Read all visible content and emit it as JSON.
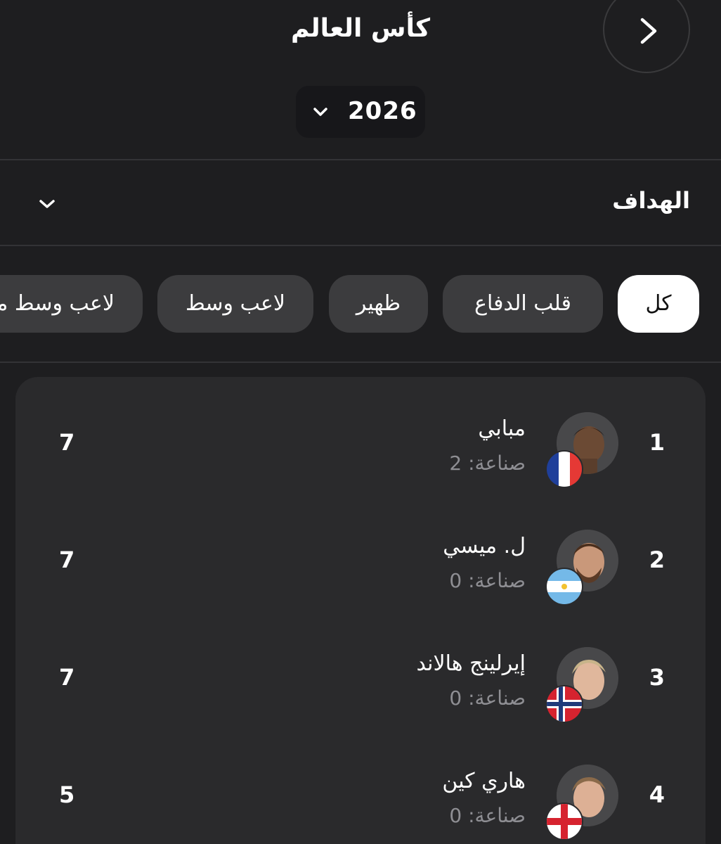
{
  "header": {
    "title": "كأس العالم",
    "year": "2026"
  },
  "stat_selector": {
    "label": "الهداف"
  },
  "positions": [
    {
      "label": "كل",
      "active": true
    },
    {
      "label": "قلب الدفاع",
      "active": false
    },
    {
      "label": "ظهير",
      "active": false
    },
    {
      "label": "لاعب وسط",
      "active": false
    },
    {
      "label": "لاعب وسط مهاجم",
      "active": false
    }
  ],
  "players": [
    {
      "rank": "1",
      "name": "مبابي",
      "assists": "صناعة: 2",
      "goals": "7",
      "flag": "france-flag",
      "avatar": "mbappe-photo"
    },
    {
      "rank": "2",
      "name": "ل. ميسي",
      "assists": "صناعة: 0",
      "goals": "7",
      "flag": "argentina-flag",
      "avatar": "messi-photo"
    },
    {
      "rank": "3",
      "name": "إيرلينج هالاند",
      "assists": "صناعة: 0",
      "goals": "7",
      "flag": "norway-flag",
      "avatar": "haaland-photo"
    },
    {
      "rank": "4",
      "name": "هاري كين",
      "assists": "صناعة: 0",
      "goals": "5",
      "flag": "england-flag",
      "avatar": "kane-photo"
    }
  ],
  "colors": {
    "background": "#1e1e20",
    "card": "#2a2a2c",
    "chip": "#3c3c3e",
    "chip_active": "#ffffff",
    "muted_text": "#8e8e93"
  }
}
